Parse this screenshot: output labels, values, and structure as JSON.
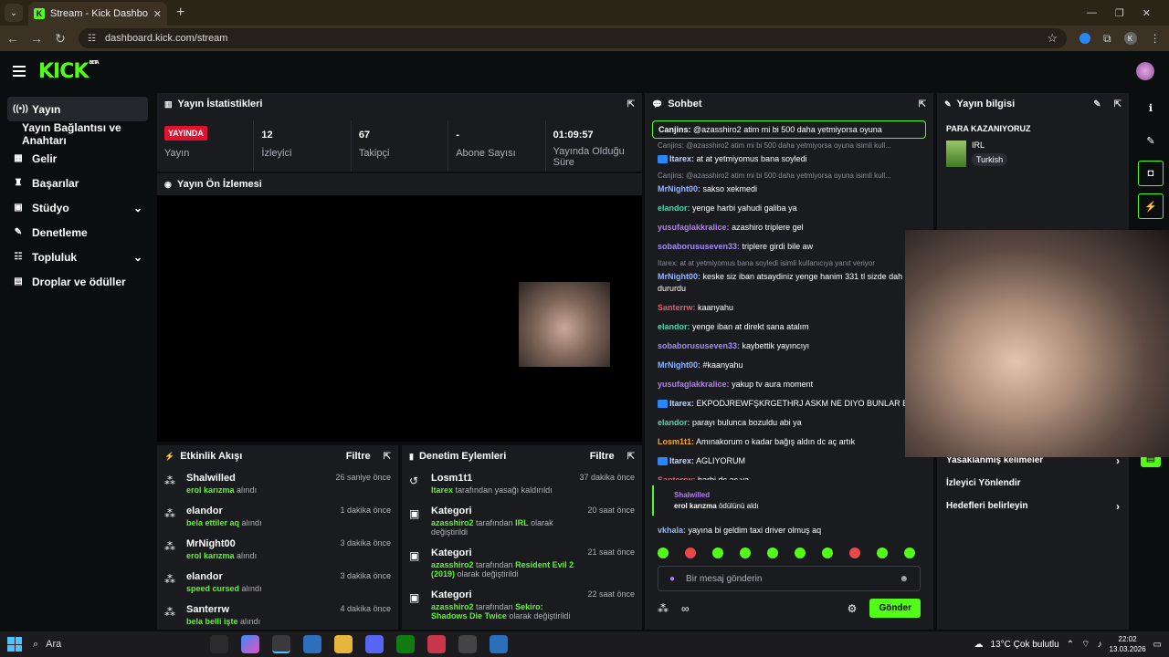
{
  "browser": {
    "tab_title": "Stream - Kick Dashboard",
    "url": "dashboard.kick.com/stream",
    "profile_initial": "K"
  },
  "header": {
    "logo": "KICK",
    "beta": "BETA"
  },
  "sidebar": {
    "items": [
      {
        "label": "Yayın"
      },
      {
        "label": "Yayın Bağlantısı ve Anahtarı"
      },
      {
        "label": "Gelir"
      },
      {
        "label": "Başarılar"
      },
      {
        "label": "Stüdyo"
      },
      {
        "label": "Denetleme"
      },
      {
        "label": "Topluluk"
      },
      {
        "label": "Droplar ve ödüller"
      }
    ]
  },
  "stats": {
    "title": "Yayın İstatistikleri",
    "live_badge": "YAYINDA",
    "live_label": "Yayın",
    "viewers_value": "12",
    "viewers_label": "İzleyici",
    "followers_value": "67",
    "followers_label": "Takipçi",
    "subs_value": "-",
    "subs_label": "Abone Sayısı",
    "uptime_value": "01:09:57",
    "uptime_label": "Yayında Olduğu Süre"
  },
  "preview": {
    "title": "Yayın Ön İzlemesi"
  },
  "activity": {
    "title": "Etkinlik Akışı",
    "filter": "Filtre",
    "rows": [
      {
        "name": "Shalwilled",
        "reward": "erol karızma",
        "suffix": "alındı",
        "time": "26 saniye önce"
      },
      {
        "name": "elandor",
        "reward": "bela ettiler aq",
        "suffix": "alındı",
        "time": "1 dakika önce"
      },
      {
        "name": "MrNight00",
        "reward": "erol karızma",
        "suffix": "alındı",
        "time": "3 dakika önce"
      },
      {
        "name": "elandor",
        "reward": "speed cursed",
        "suffix": "alındı",
        "time": "3 dakika önce"
      },
      {
        "name": "Santerrw",
        "reward": "bela belli işte",
        "suffix": "alındı",
        "time": "4 dakika önce"
      }
    ]
  },
  "moderation": {
    "title": "Denetim Eylemleri",
    "filter": "Filtre",
    "rows": [
      {
        "name": "Losm1t1",
        "actor": "Itarex",
        "desc": "tarafından yasağı kaldırıldı",
        "value": "",
        "tail": "",
        "time": "37 dakika önce"
      },
      {
        "name": "Kategori",
        "actor": "azasshiro2",
        "desc": "tarafından",
        "value": "IRL",
        "tail": "olarak değiştirildi",
        "time": "20 saat önce"
      },
      {
        "name": "Kategori",
        "actor": "azasshiro2",
        "desc": "tarafından",
        "value": "Resident Evil 2 (2019)",
        "tail": "olarak değiştirildi",
        "time": "21 saat önce"
      },
      {
        "name": "Kategori",
        "actor": "azasshiro2",
        "desc": "tarafından",
        "value": "Sekiro: Shadows Die Twice",
        "tail": "olarak değiştirildi",
        "time": "22 saat önce"
      }
    ]
  },
  "chat": {
    "title": "Sohbet",
    "pinned_user": "Canjins:",
    "pinned_text": "@azasshiro2 atim mi bi 500 daha yetmiyorsa oyuna",
    "messages": [
      {
        "reply": "Canjins: @azasshiro2 atim mi bi 500 daha yetmiyorsa oyuna isimli kull...",
        "user": "Itarex:",
        "text": "at at yetmiyomus bana soyledi",
        "color": "#c7d2f7",
        "badge": true
      },
      {
        "reply": "Canjins: @azasshiro2 atim mi bi 500 daha yetmiyorsa oyuna isimli kull...",
        "user": "MrNight00:",
        "text": "sakso xekmedi",
        "color": "#8fb4ff",
        "badge": false
      },
      {
        "reply": "",
        "user": "elandor:",
        "text": "yenge harbi yahudi galiba ya",
        "color": "#4fd4a8",
        "badge": false
      },
      {
        "reply": "",
        "user": "yusufaglakkralice:",
        "text": "azashiro triplere gel",
        "color": "#b57cf7",
        "badge": false
      },
      {
        "reply": "",
        "user": "sobaborususeven33:",
        "text": "triplere girdi bile aw",
        "color": "#a58cf7",
        "badge": false
      },
      {
        "reply": "Itarex: at at yetmiyomus bana soyledi isimli kullanıcıya yanıt veriyor",
        "user": "MrNight00:",
        "text": "keske siz iban atsaydiniz yenge hanim 331 tl sizde dah iyi dururdu",
        "color": "#8fb4ff",
        "badge": false
      },
      {
        "reply": "",
        "user": "Santerrw:",
        "text": "kaanyahu",
        "color": "#e85a6a",
        "badge": false
      },
      {
        "reply": "",
        "user": "elandor:",
        "text": "yenge iban at direkt sana atalım",
        "color": "#4fd4a8",
        "badge": false
      },
      {
        "reply": "",
        "user": "sobaborususeven33:",
        "text": "kaybettik yayıncıyı",
        "color": "#a58cf7",
        "badge": false
      },
      {
        "reply": "",
        "user": "MrNight00:",
        "text": "#kaanyahu",
        "color": "#8fb4ff",
        "badge": false
      },
      {
        "reply": "",
        "user": "yusufaglakkralice:",
        "text": "yakup tv aura moment",
        "color": "#b57cf7",
        "badge": false
      },
      {
        "reply": "",
        "user": "Itarex:",
        "text": "EKPODJREWFŞKRGETHRJ ASKM NE DIYO BUNLAR BAI",
        "color": "#c7d2f7",
        "badge": true
      },
      {
        "reply": "",
        "user": "elandor:",
        "text": "parayı bulunca bozuldu abi ya",
        "color": "#4fd4a8",
        "badge": false
      },
      {
        "reply": "",
        "user": "Losm1t1:",
        "text": "Amınakorum o kadar bağış aldın dc aç artık",
        "color": "#f5a623",
        "badge": false
      },
      {
        "reply": "",
        "user": "Itarex:",
        "text": "AGLIYORUM",
        "color": "#c7d2f7",
        "badge": true
      },
      {
        "reply": "",
        "user": "Santerrw:",
        "text": "harbi dc aç ya",
        "color": "#e85a6a",
        "badge": false
      }
    ],
    "reward_user": "Shalwilled",
    "reward_name": "erol karızma",
    "reward_text": "ödülünü aldı",
    "last_user": "vkhala:",
    "last_text": "yayına bi geldim taxi driver olmuş aq",
    "placeholder": "Bir mesaj gönderin",
    "send": "Gönder"
  },
  "info": {
    "title": "Yayın bilgisi",
    "stream_title": "PARA KAZANIYORUZ",
    "category": "IRL",
    "tag": "Turkish",
    "links": [
      "Yasaklanmış kelimeler",
      "İzleyici Yönlendir",
      "Hedefleri belirleyin"
    ]
  },
  "taskbar": {
    "search": "Ara",
    "weather": "13°C  Çok bulutlu",
    "time": "22:02",
    "date": "13.03.2026"
  }
}
